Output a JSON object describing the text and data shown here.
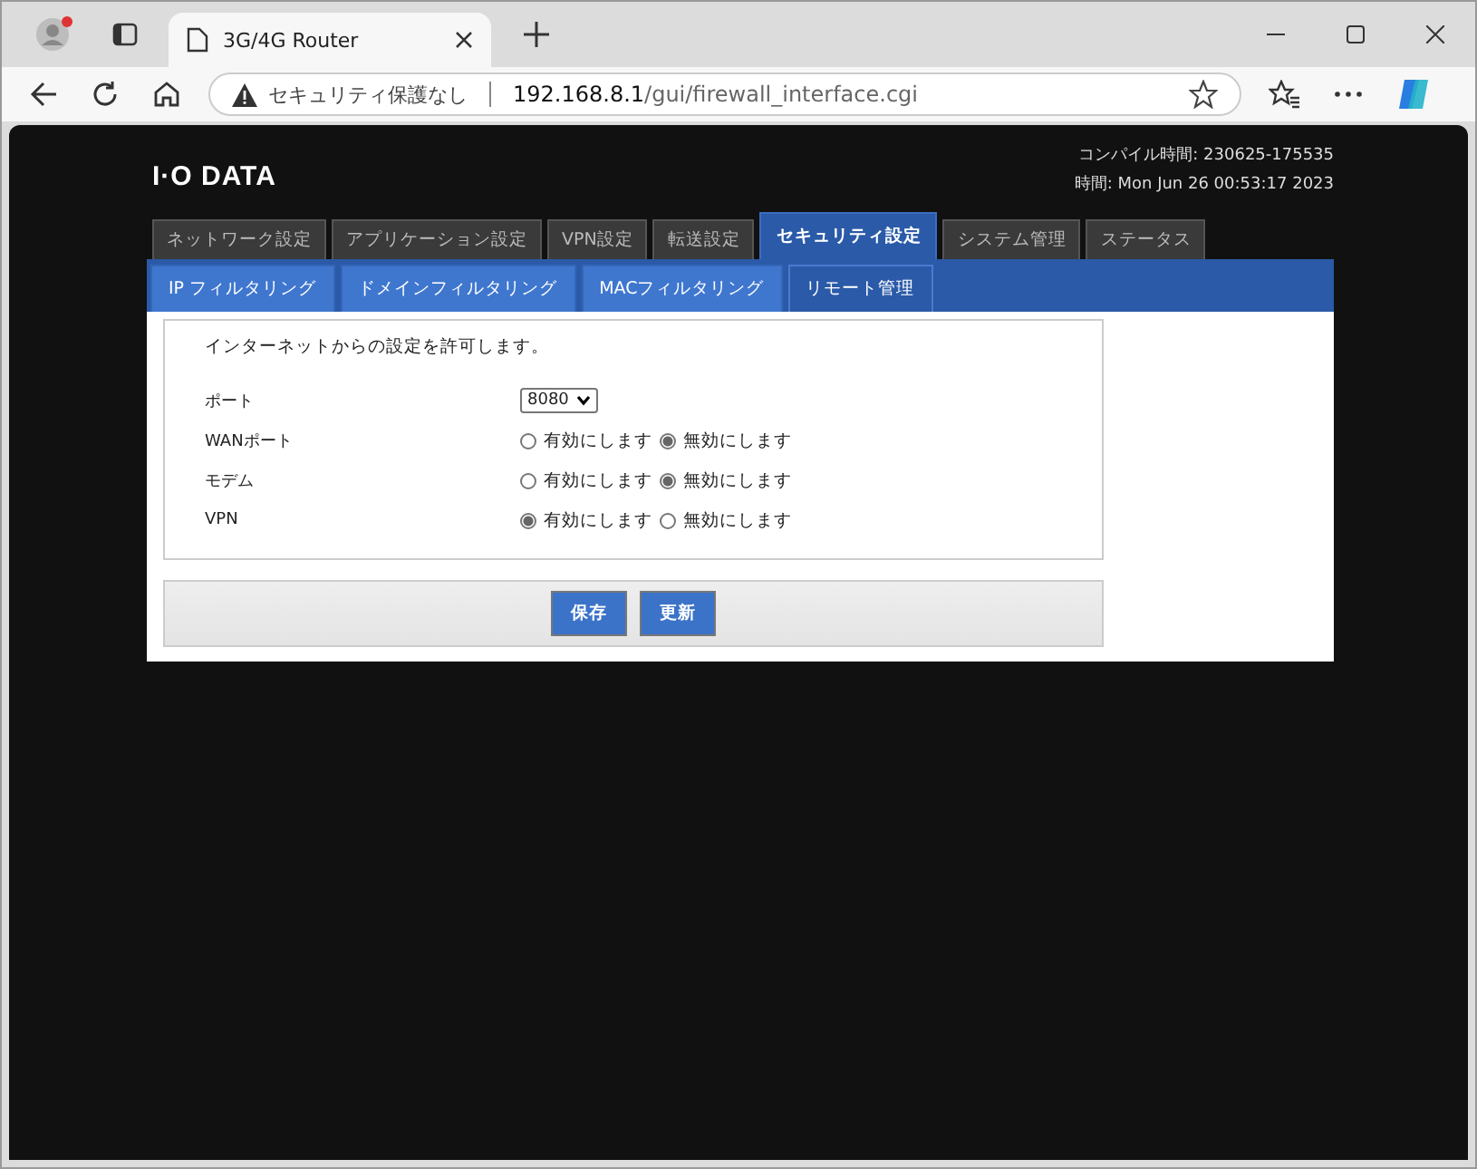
{
  "browser": {
    "tab_title": "3G/4G Router",
    "security_label": "セキュリティ保護なし",
    "url_host": "192.168.8.1",
    "url_path": "/gui/firewall_interface.cgi"
  },
  "header": {
    "logo": "I·O DATA",
    "compile_time": "コンパイル時間: 230625-175535",
    "time": "時間: Mon Jun 26 00:53:17 2023"
  },
  "main_tabs": [
    {
      "label": "ネットワーク設定",
      "selected": false
    },
    {
      "label": "アプリケーション設定",
      "selected": false
    },
    {
      "label": "VPN設定",
      "selected": false
    },
    {
      "label": "転送設定",
      "selected": false
    },
    {
      "label": "セキュリティ設定",
      "selected": true
    },
    {
      "label": "システム管理",
      "selected": false
    },
    {
      "label": "ステータス",
      "selected": false
    }
  ],
  "sub_tabs": [
    {
      "label": "IP フィルタリング",
      "selected": false
    },
    {
      "label": "ドメインフィルタリング",
      "selected": false
    },
    {
      "label": "MACフィルタリング",
      "selected": false
    },
    {
      "label": "リモート管理",
      "selected": true
    }
  ],
  "description": "インターネットからの設定を許可します。",
  "rows": [
    {
      "kind": "select",
      "label": "ポート",
      "value": "8080"
    },
    {
      "kind": "radio",
      "label": "WANポート",
      "options": [
        {
          "label": "有効にします",
          "selected": false
        },
        {
          "label": "無効にします",
          "selected": true
        }
      ]
    },
    {
      "kind": "radio",
      "label": "モデム",
      "options": [
        {
          "label": "有効にします",
          "selected": false
        },
        {
          "label": "無効にします",
          "selected": true
        }
      ]
    },
    {
      "kind": "radio",
      "label": "VPN",
      "options": [
        {
          "label": "有効にします",
          "selected": true
        },
        {
          "label": "無効にします",
          "selected": false
        }
      ]
    }
  ],
  "buttons": [
    "保存",
    "更新"
  ]
}
